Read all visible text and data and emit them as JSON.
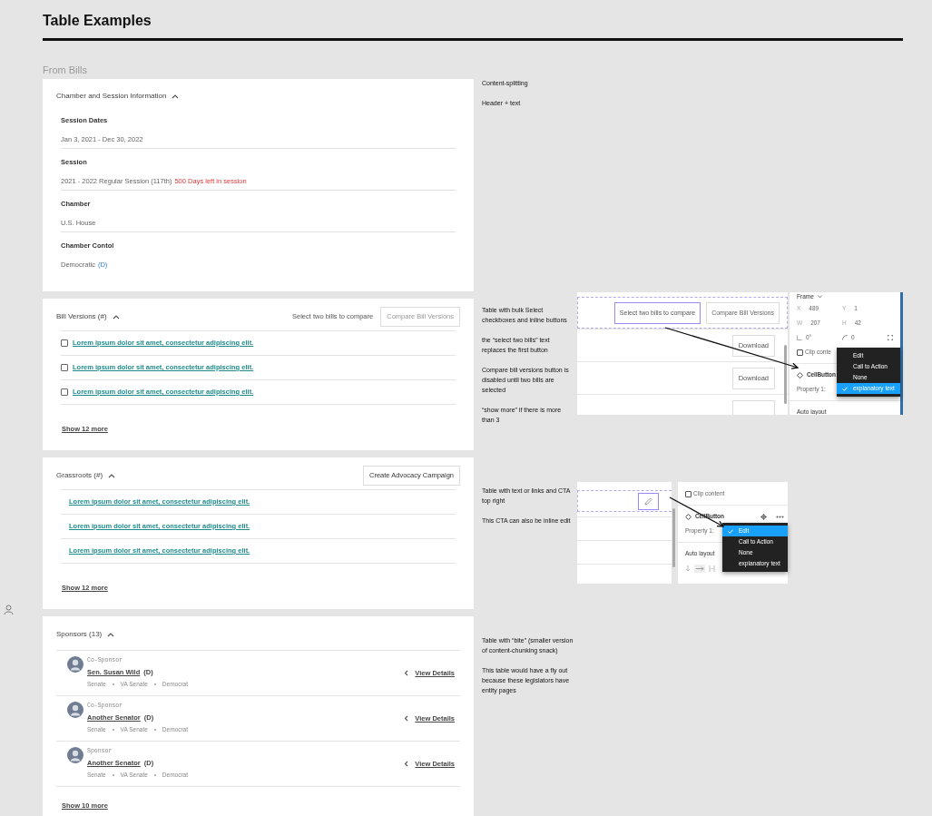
{
  "page_title": "Table Examples",
  "section_title": "From Bills",
  "chamber_card": {
    "title": "Chamber and Session Information",
    "expanded": true,
    "fields": [
      {
        "label": "Session Dates",
        "value": "Jan 3, 2021 - Dec 30, 2022"
      },
      {
        "label": "Session",
        "value": "2021 - 2022 Regular Session (117th)",
        "note": "500 Days left in session"
      },
      {
        "label": "Chamber",
        "value": "U.S. House"
      },
      {
        "label": "Chamber Contol",
        "value": "Democratic",
        "party": "(D)"
      }
    ]
  },
  "bill_versions": {
    "title": "Bill Versions (#)",
    "expanded": true,
    "hint": "Select two bills to compare",
    "button": {
      "label": "Compare Bill Versions",
      "disabled": true
    },
    "rows": [
      {
        "label": "Lorem ipsum dolor sit amet, consectetur adipiscing elit.",
        "checked": false
      },
      {
        "label": "Lorem ipsum dolor sit amet, consectetur adipiscing elit.",
        "checked": false
      },
      {
        "label": "Lorem ipsum dolor sit amet, consectetur adipiscing elit.",
        "checked": false
      }
    ],
    "show_more": "Show 12 more"
  },
  "grassroots": {
    "title": "Grassroots (#)",
    "expanded": true,
    "button": {
      "label": "Create Advocacy Campaign",
      "disabled": false
    },
    "rows": [
      {
        "label": "Lorem ipsum dolor sit amet, consectetur adipiscing elit."
      },
      {
        "label": "Lorem ipsum dolor sit amet, consectetur adipiscing elit."
      },
      {
        "label": "Lorem ipsum dolor sit amet, consectetur adipiscing elit."
      }
    ],
    "show_more": "Show 12 more"
  },
  "sponsors": {
    "title": "Sponsors (13)",
    "expanded": true,
    "items": [
      {
        "role": "Co-Sponsor",
        "name": "Sen. Susan Wild",
        "party": "(D)",
        "meta": [
          "Senate",
          "VA Senate",
          "Democrat"
        ],
        "action": "View Details"
      },
      {
        "role": "Co-Sponsor",
        "name": "Another Senator",
        "party": "(D)",
        "meta": [
          "Senate",
          "VA Senate",
          "Democrat"
        ],
        "action": "View Details"
      },
      {
        "role": "Sponsor",
        "name": "Another Senator",
        "party": "(D)",
        "meta": [
          "Senate",
          "VA Senate",
          "Democrat"
        ],
        "action": "View Details"
      }
    ],
    "show_more": "Show 10 more"
  },
  "notes": [
    {
      "paragraphs": [
        "Content-splitting",
        "Header + text"
      ]
    },
    {
      "paragraphs": [
        "Table with bulk Select checkboxes and inline buttons",
        "the “select two bills” text replaces the first button",
        "Compare bill versions button is disabled until two bills are selected",
        "“show more” if there is more than 3"
      ]
    },
    {
      "paragraphs": [
        "Table with text or links and CTA top right",
        "This CTA can also be inline edit"
      ]
    },
    {
      "paragraphs": [
        "Table with “bite” (smaller version of content-chunking snack)",
        "This table would have a fly out because these legislators have entity pages"
      ]
    }
  ],
  "mockups": [
    {
      "kind": "buttons",
      "buttons": [
        {
          "label": "Select two bills to compare",
          "selected": true
        },
        {
          "label": "Compare Bill Versions",
          "selected": false
        }
      ],
      "row_buttons": [
        "Download",
        "Download"
      ],
      "panel": {
        "frame_title": "Frame",
        "fields": [
          {
            "label": "X",
            "value": "489"
          },
          {
            "label": "Y",
            "value": "1"
          },
          {
            "label": "W",
            "value": "207"
          },
          {
            "label": "H",
            "value": "42"
          },
          {
            "kind": "rotation",
            "value": "0°"
          },
          {
            "kind": "radius",
            "value": "0"
          }
        ],
        "clip_label": "Clip conte",
        "clip_checked": false,
        "component": "CellButton",
        "property_label": "Property 1:",
        "auto_layout": "Auto layout",
        "menu": [
          {
            "label": "Edit",
            "selected": false
          },
          {
            "label": "Call to Action",
            "selected": false
          },
          {
            "label": "None",
            "selected": false
          },
          {
            "label": "explanatory text",
            "selected": true
          }
        ]
      }
    },
    {
      "kind": "edit",
      "panel": {
        "clip_label": "Clip content",
        "clip_checked": false,
        "component": "CellButton",
        "property_label": "Property 1:",
        "auto_layout": "Auto layout",
        "menu": [
          {
            "label": "Edit",
            "selected": true
          },
          {
            "label": "Call to Action",
            "selected": false
          },
          {
            "label": "None",
            "selected": false
          },
          {
            "label": "explanatory text",
            "selected": false
          }
        ]
      }
    }
  ]
}
